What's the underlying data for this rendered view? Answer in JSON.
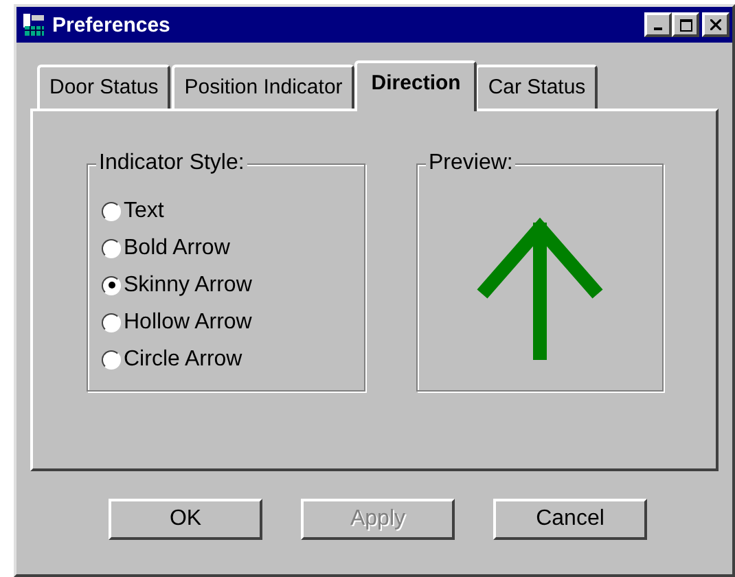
{
  "window": {
    "title": "Preferences"
  },
  "tabs": [
    {
      "label": "Door Status",
      "selected": false
    },
    {
      "label": "Position Indicator",
      "selected": false
    },
    {
      "label": "Direction",
      "selected": true
    },
    {
      "label": "Car Status",
      "selected": false
    }
  ],
  "indicator_style": {
    "title": "Indicator Style:",
    "options": [
      {
        "label": "Text",
        "selected": false
      },
      {
        "label": "Bold Arrow",
        "selected": false
      },
      {
        "label": "Skinny Arrow",
        "selected": true
      },
      {
        "label": "Hollow Arrow",
        "selected": false
      },
      {
        "label": "Circle Arrow",
        "selected": false
      }
    ]
  },
  "preview": {
    "title": "Preview:",
    "color": "#008000"
  },
  "buttons": [
    {
      "label": "OK",
      "disabled": false
    },
    {
      "label": "Apply",
      "disabled": true
    },
    {
      "label": "Cancel",
      "disabled": false
    }
  ]
}
